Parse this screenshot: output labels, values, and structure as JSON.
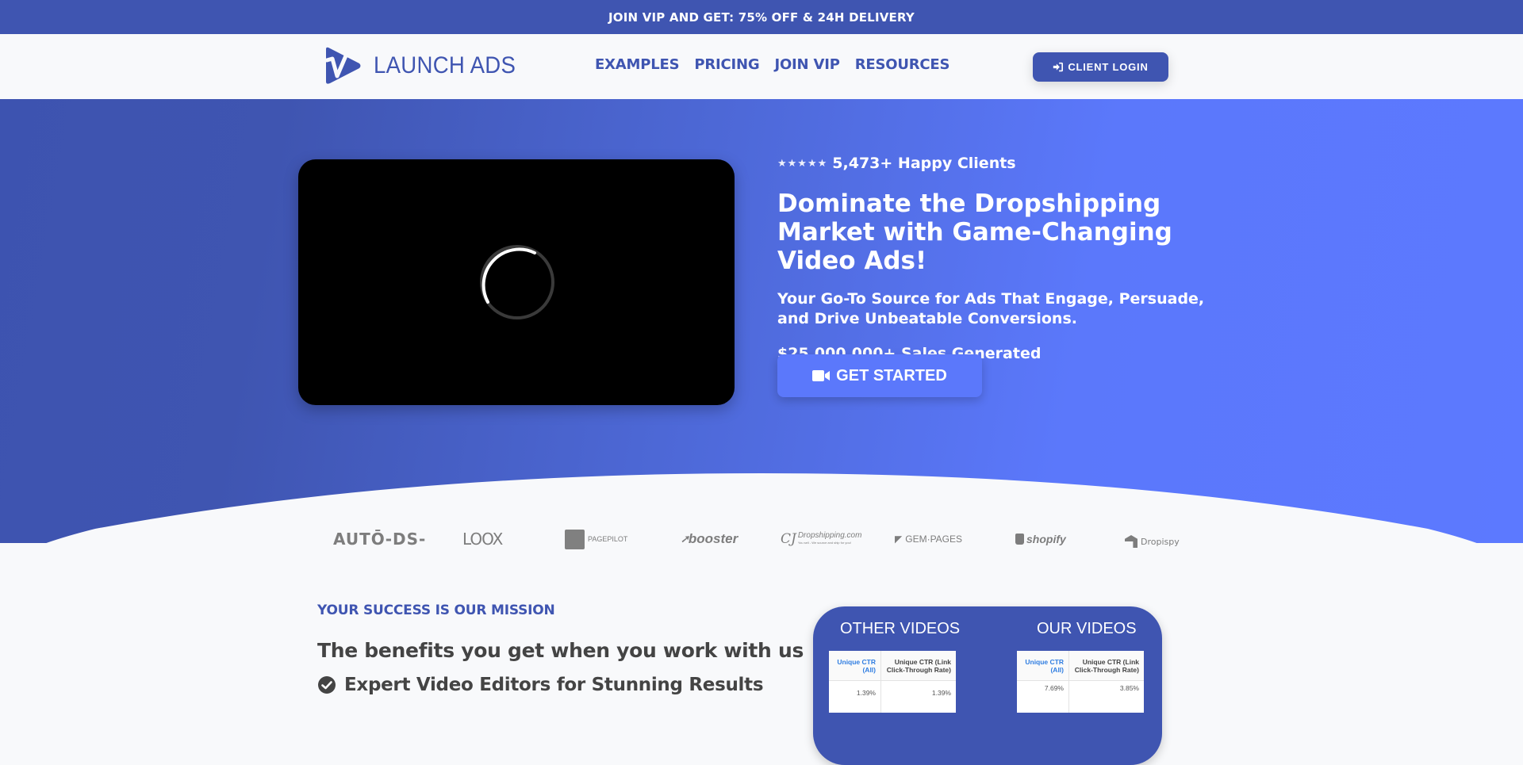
{
  "promo_bar": {
    "text": "JOIN VIP AND GET: 75% OFF & 24H DELIVERY"
  },
  "header": {
    "logo_text": "LAUNCH ADS",
    "nav": [
      {
        "label": "EXAMPLES"
      },
      {
        "label": "PRICING"
      },
      {
        "label": "JOIN VIP"
      },
      {
        "label": "RESOURCES"
      }
    ],
    "login_button": {
      "label": "CLIENT LOGIN",
      "icon": "sign-in-icon"
    }
  },
  "hero": {
    "video": {
      "state": "loading",
      "icon": "loading-spinner-icon"
    },
    "rating": {
      "stars": "★★★★★",
      "text": "5,473+ Happy Clients"
    },
    "headline": "Dominate the Dropshipping Market with Game-Changing Video Ads!",
    "subheadline": "Your Go-To Source for Ads That Engage, Persuade, and Drive Unbeatable Conversions.",
    "sales": "$25,000,000+ Sales Generated",
    "cta": {
      "label": "GET STARTED",
      "icon": "video-camera-icon"
    }
  },
  "partner_logos": [
    {
      "name": "AUTO-DS",
      "text": "AUTŌ-DS-"
    },
    {
      "name": "LOOX",
      "text": "LOOX"
    },
    {
      "name": "PagePilot",
      "text": "PAGEPILOT"
    },
    {
      "name": "Booster",
      "text": "booster"
    },
    {
      "name": "CJ Dropshipping",
      "text": "Dropshipping.com",
      "tagline": "You sell - We source and ship for you!"
    },
    {
      "name": "GemPages",
      "text": "GEM·PAGES"
    },
    {
      "name": "Shopify",
      "text": "shopify"
    },
    {
      "name": "Dropispy",
      "text": "Dropispy"
    }
  ],
  "benefits": {
    "kicker": "YOUR SUCCESS IS OUR MISSION",
    "title": "The benefits you get when you work with us",
    "items": [
      {
        "text": "Expert Video Editors for Stunning Results",
        "icon": "check-circle-icon"
      }
    ]
  },
  "comparison": {
    "columns": [
      {
        "title": "OTHER VIDEOS",
        "headers": [
          "Unique CTR (All)",
          "Unique CTR (Link Click-Through Rate)"
        ],
        "rows": [
          [
            "1.39%",
            "1.39%"
          ]
        ]
      },
      {
        "title": "OUR VIDEOS",
        "headers": [
          "Unique CTR (All)",
          "Unique CTR (Link Click-Through Rate)"
        ],
        "rows": [
          [
            "7.69%",
            "3.85%"
          ]
        ]
      }
    ]
  },
  "colors": {
    "brand_dark": "#3f55b1",
    "brand_light": "#5c79ff",
    "page_bg": "#f8f9fb",
    "text_dark": "#444444",
    "logo_gray": "#7d7d7d"
  }
}
